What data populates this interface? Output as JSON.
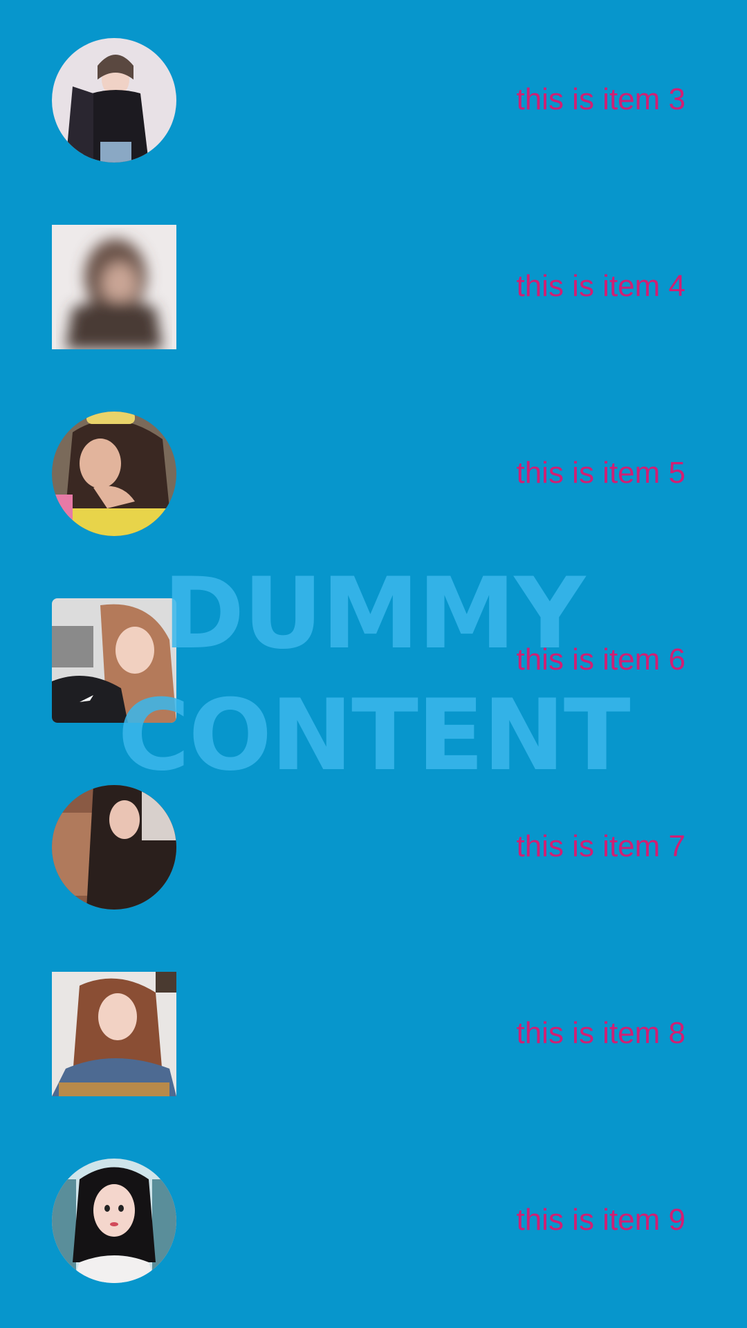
{
  "colors": {
    "background": "#0796cc",
    "label": "#d11f73",
    "watermark": "#3bb8ec"
  },
  "items": [
    {
      "label": "this is item 3",
      "image": "portrait-photo",
      "shape": "circle"
    },
    {
      "label": "this is item 4",
      "image": "blurred-portrait-photo",
      "shape": "square"
    },
    {
      "label": "this is item 5",
      "image": "portrait-photo",
      "shape": "circle"
    },
    {
      "label": "this is item 6",
      "image": "portrait-photo",
      "shape": "rounded-square"
    },
    {
      "label": "this is item 7",
      "image": "portrait-photo",
      "shape": "circle"
    },
    {
      "label": "this is item 8",
      "image": "portrait-photo",
      "shape": "square"
    },
    {
      "label": "this is item 9",
      "image": "portrait-photo",
      "shape": "circle"
    }
  ],
  "watermark": {
    "line1": "DUMMY",
    "line2": "CONTENT"
  }
}
